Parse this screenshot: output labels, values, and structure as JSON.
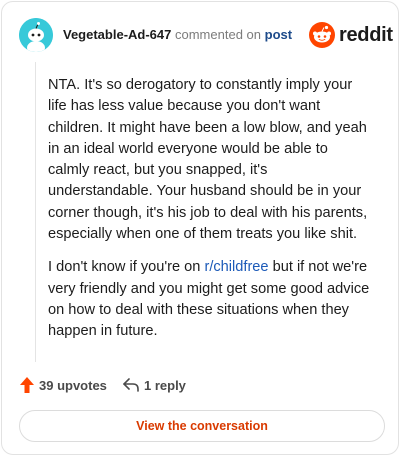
{
  "header": {
    "username": "Vegetable-Ad-647",
    "commented_text": "commented on",
    "post_link": "post",
    "logo_text": "reddit"
  },
  "comment": {
    "paragraph1": "NTA. It's so derogatory to constantly imply your life has less value because you don't want children. It might have been a low blow, and yeah in an ideal world everyone would be able to calmly react, but you snapped, it's understandable. Your husband should be in your corner though, it's his job to deal with his parents, especially when one of them treats you like shit.",
    "paragraph2_before": "I don't know if you're on ",
    "subreddit": "r/childfree",
    "paragraph2_after": " but if not we're very friendly and you might get some good advice on how to deal with these situations when they happen in future."
  },
  "actions": {
    "upvotes": "39 upvotes",
    "replies": "1 reply"
  },
  "cta": {
    "label": "View the conversation"
  },
  "colors": {
    "avatar_bg": "#37c9d9",
    "upvote_orange": "#ff4500",
    "link_blue": "#1c5ab8",
    "cta_text": "#d93a00"
  },
  "icons": [
    "snoo-avatar-icon",
    "reddit-logo-icon",
    "upvote-arrow-icon",
    "reply-arrow-icon"
  ]
}
